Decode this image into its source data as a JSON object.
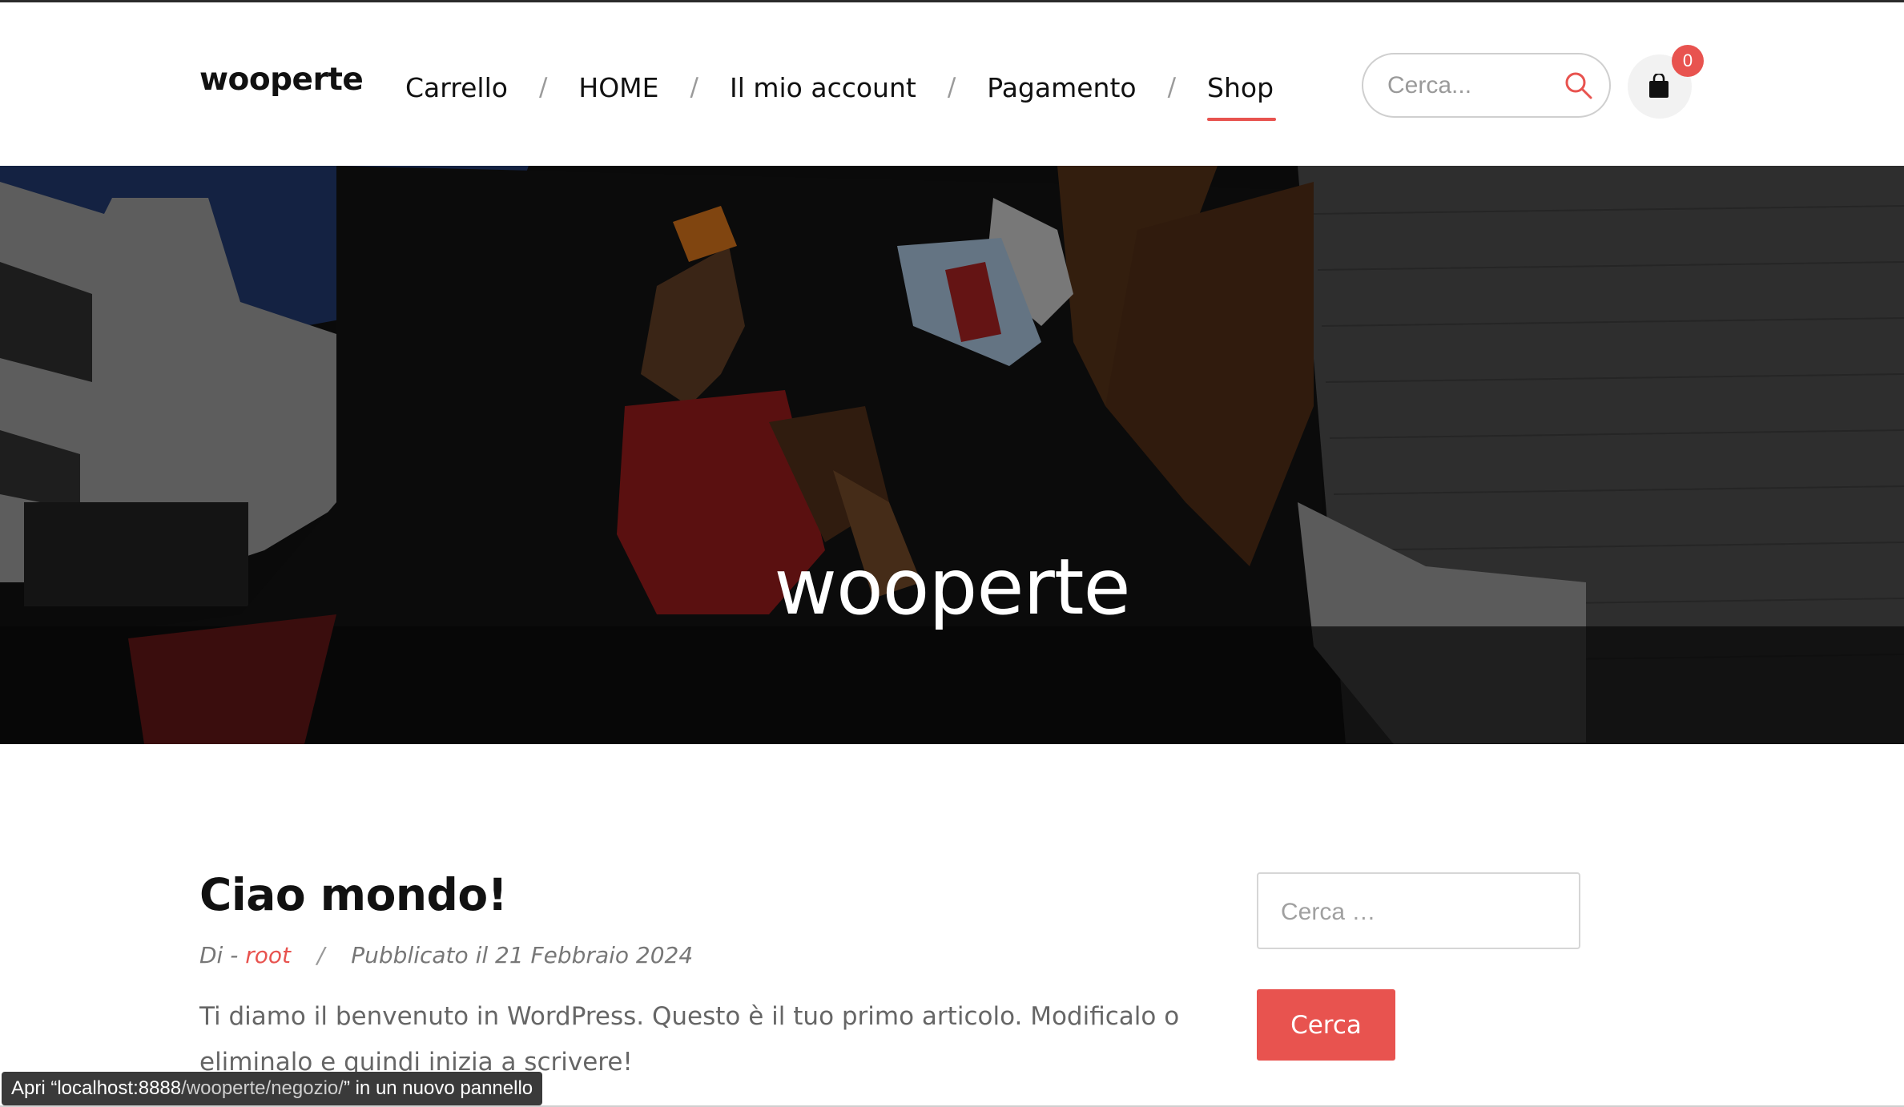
{
  "header": {
    "logo": "wooperte",
    "nav": [
      {
        "label": "Carrello"
      },
      {
        "label": "HOME"
      },
      {
        "label": "Il mio account"
      },
      {
        "label": "Pagamento"
      },
      {
        "label": "Shop",
        "active": true
      }
    ],
    "nav_separator": "/",
    "search_placeholder": "Cerca...",
    "cart_count": "0"
  },
  "hero": {
    "title": "wooperte"
  },
  "post": {
    "title": "Ciao mondo!",
    "meta_prefix": "Di -",
    "author": "root",
    "meta_separator": "/",
    "published": "Pubblicato il 21 Febbraio 2024",
    "excerpt": "Ti diamo il benvenuto in WordPress. Questo è il tuo primo articolo. Modificalo o eliminalo e quindi inizia a scrivere!"
  },
  "sidebar": {
    "search_placeholder": "Cerca …",
    "search_button": "Cerca"
  },
  "status_bar": {
    "prefix": "Apri “localhost:8888",
    "path": "/wooperte/negozio/",
    "suffix": "” in un nuovo pannello"
  },
  "colors": {
    "accent": "#e8534f",
    "text": "#111111",
    "muted": "#777777"
  },
  "icons": {
    "search": "search-icon",
    "cart": "shopping-bag-icon"
  }
}
